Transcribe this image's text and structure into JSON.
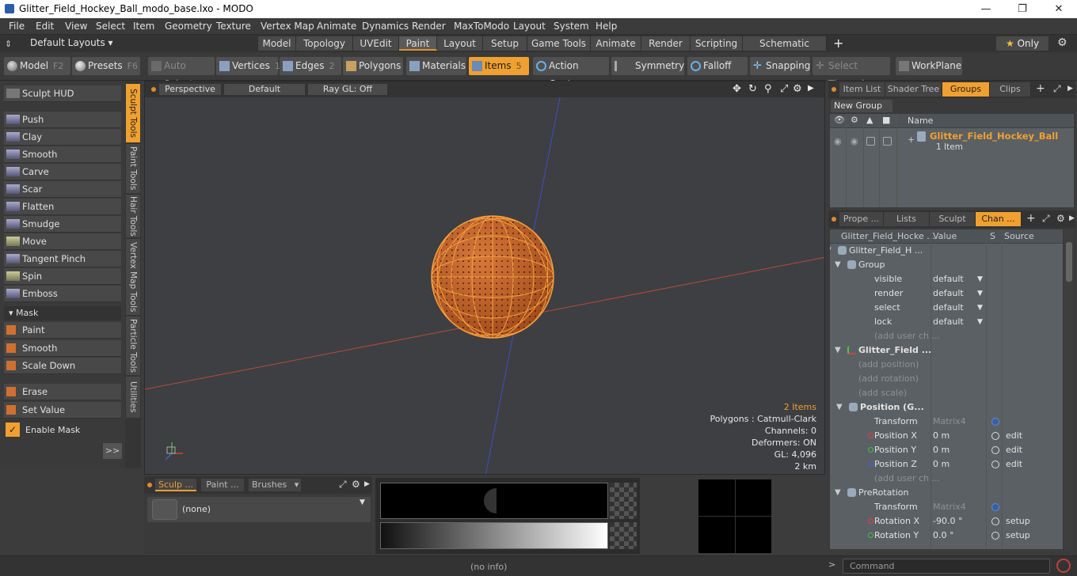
{
  "title": "Glitter_Field_Hockey_Ball_modo_base.lxo - MODO",
  "menu": [
    "File",
    "Edit",
    "View",
    "Select",
    "Item",
    "Geometry",
    "Texture",
    "Vertex Map",
    "Animate",
    "Dynamics",
    "Render",
    "MaxToModo",
    "Layout",
    "System",
    "Help"
  ],
  "layouts_dropdown": "Default Layouts ▾",
  "layout_tabs": [
    "Model",
    "Topology",
    "UVEdit",
    "Paint",
    "Layout",
    "Setup",
    "Game Tools",
    "Animate",
    "Render",
    "Scripting",
    "Schematic Fusion"
  ],
  "active_layout_tab": "Paint",
  "only_label": "Only",
  "toolbar": {
    "model": "Model",
    "model_key": "F2",
    "presets": "Presets",
    "presets_key": "F6",
    "auto_select": "Auto Select",
    "vertices": "Vertices",
    "vertices_key": "1",
    "edges": "Edges",
    "edges_key": "2",
    "polygons": "Polygons",
    "materials": "Materials",
    "items": "Items",
    "items_key": "5",
    "action_center": "Action Center",
    "symmetry": "Symmetry",
    "falloff": "Falloff",
    "snapping": "Snapping",
    "select_through": "Select Through",
    "workplane": "WorkPlane"
  },
  "left_panel": {
    "sculpt_hud": "Sculpt HUD",
    "tools": [
      "Push",
      "Clay",
      "Smooth",
      "Carve",
      "Scar",
      "Flatten",
      "Smudge",
      "Move",
      "Tangent Pinch",
      "Spin",
      "Emboss"
    ],
    "mask_header": "Mask",
    "mask_tools": [
      "Paint",
      "Smooth",
      "Scale Down"
    ],
    "erase": "Erase",
    "set_value": "Set Value",
    "enable_mask": "Enable Mask",
    "more": ">>"
  },
  "vertical_tabs": [
    "Sculpt Tools",
    "Paint Tools",
    "Hair Tools",
    "Vertex Map Tools",
    "Particle Tools",
    "Utilities"
  ],
  "viewport": {
    "view": "Perspective",
    "shading": "Default",
    "raygl": "Ray GL: Off",
    "info": [
      "2 Items",
      "Polygons : Catmull-Clark",
      "Channels: 0",
      "Deformers: ON",
      "GL: 4,096",
      "2 km"
    ]
  },
  "bottom_panel": {
    "tabs": [
      "Sculp ...",
      "Paint ...",
      "Brushes"
    ],
    "brush_value": "(none)"
  },
  "status": "(no info)",
  "command_placeholder": "Command",
  "right_top": {
    "tabs": [
      "Item List",
      "Shader Tree",
      "Groups",
      "Clips"
    ],
    "active_tab": "Groups",
    "new_group": "New Group",
    "col_name": "Name",
    "group_name": "Glitter_Field_Hockey_Ball",
    "group_sub": "1 Item"
  },
  "right_bottom": {
    "tabs": [
      "Prope ...",
      "Lists",
      "Sculpt",
      "Chan ..."
    ],
    "active_tab": "Chan ...",
    "cols": [
      "Glitter_Field_Hocke ...",
      "Value",
      "S",
      "Source"
    ],
    "rows": [
      {
        "name": "Glitter_Field_H ...",
        "value": "",
        "src": "",
        "style": "item"
      },
      {
        "name": "Group",
        "value": "",
        "src": "",
        "style": "group"
      },
      {
        "name": "visible",
        "value": "default",
        "src": "",
        "style": "dd"
      },
      {
        "name": "render",
        "value": "default",
        "src": "",
        "style": "dd"
      },
      {
        "name": "select",
        "value": "default",
        "src": "",
        "style": "dd"
      },
      {
        "name": "lock",
        "value": "default",
        "src": "",
        "style": "dd"
      },
      {
        "name": "(add user ch ...",
        "value": "",
        "src": "",
        "style": "gray"
      },
      {
        "name": "Glitter_Field ...",
        "value": "",
        "src": "",
        "style": "bold"
      },
      {
        "name": "(add position)",
        "value": "",
        "src": "",
        "style": "gray2"
      },
      {
        "name": "(add rotation)",
        "value": "",
        "src": "",
        "style": "gray2"
      },
      {
        "name": "(add scale)",
        "value": "",
        "src": "",
        "style": "gray2"
      },
      {
        "name": "Position (G...",
        "value": "",
        "src": "",
        "style": "bold2"
      },
      {
        "name": "Transform",
        "value": "Matrix4",
        "src": "",
        "style": "matrix"
      },
      {
        "name": "Position X",
        "value": "0 m",
        "src": "edit",
        "style": "chan",
        "color": "#e04040"
      },
      {
        "name": "Position Y",
        "value": "0 m",
        "src": "edit",
        "style": "chan",
        "color": "#40c040"
      },
      {
        "name": "Position Z",
        "value": "0 m",
        "src": "edit",
        "style": "chan",
        "color": "#4060e0"
      },
      {
        "name": "(add user ch ...",
        "value": "",
        "src": "",
        "style": "gray"
      },
      {
        "name": "PreRotation",
        "value": "",
        "src": "",
        "style": "group"
      },
      {
        "name": "Transform",
        "value": "Matrix4",
        "src": "",
        "style": "matrix"
      },
      {
        "name": "Rotation X",
        "value": "-90.0 °",
        "src": "setup",
        "style": "chan",
        "color": "#e04040"
      },
      {
        "name": "Rotation Y",
        "value": "0.0 °",
        "src": "setup",
        "style": "chan",
        "color": "#40c040"
      }
    ]
  },
  "colors": {
    "accent": "#f0a030",
    "ball": "#c8682a",
    "wire": "#f5a040"
  }
}
